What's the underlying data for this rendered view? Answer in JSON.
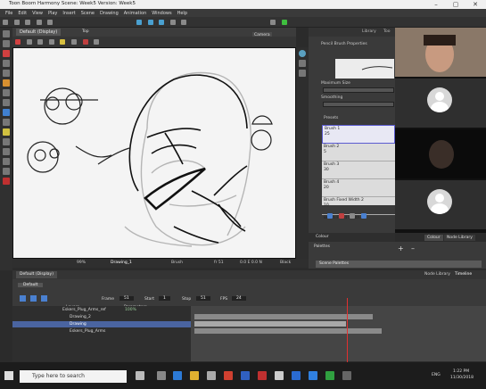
{
  "window": {
    "title": "Toon Boom Harmony Scene: Week5 Version: Week5",
    "controls": [
      "–",
      "▢",
      "✕"
    ]
  },
  "menu": [
    "File",
    "Edit",
    "View",
    "Play",
    "Insert",
    "Scene",
    "Drawing",
    "Animation",
    "Windows",
    "Help"
  ],
  "drawing_view": {
    "tab_label": "Default (Display)",
    "top_label": "Top",
    "camera_tab": "Camera",
    "drawing_tab": "Drawing"
  },
  "status": {
    "zoom": "99%",
    "drawing": "Drawing_1",
    "tool": "Brush",
    "frame": "fr 51",
    "coords": "0.0 E 0.0 N",
    "black": "Black"
  },
  "tool_properties": {
    "tabs": [
      "Library",
      "Too"
    ],
    "header": "Pencil Brush Properties",
    "max_size_label": "Maximum Size",
    "smoothing_label": "Smoothing",
    "presets_label": "Presets",
    "presets": [
      {
        "name": "Brush 1",
        "value": "25",
        "selected": true
      },
      {
        "name": "Brush 2",
        "value": "5"
      },
      {
        "name": "Brush 3",
        "value": "30"
      },
      {
        "name": "Brush 4",
        "value": "20"
      },
      {
        "name": "Brush Fixed Width 2",
        "value": "10"
      },
      {
        "name": "Brush Fixed Width 1",
        "value": ""
      }
    ]
  },
  "colour": {
    "tabs": [
      "Colour",
      "Node Library"
    ]
  },
  "palettes": {
    "label": "Palettes",
    "item": "Scene Palettes"
  },
  "timeline": {
    "tab_label": "Default (Display)",
    "tabs": [
      "Node Library",
      "Timeline"
    ],
    "default_view": "Default",
    "frame_label": "Frame",
    "frame_value": "51",
    "start_label": "Start",
    "start_value": "1",
    "stop_label": "Stop",
    "stop_value": "51",
    "fps_label": "FPS",
    "fps_value": "24",
    "layers_header": "Layers",
    "parameters_header": "Parameters",
    "layers": [
      {
        "name": "Eskers_Plug_Arms_ref",
        "value": "100%"
      },
      {
        "name": "Drawing_2",
        "value": ""
      },
      {
        "name": "Drawing",
        "value": ""
      },
      {
        "name": "Eskers_Plug_Arms",
        "value": ""
      }
    ]
  },
  "taskbar": {
    "search_placeholder": "Type here to search",
    "time": "1:22 PM",
    "date": "11/30/2018",
    "lang": "ENG"
  },
  "colors": {
    "accent": "#5b5bd0",
    "playhead": "#e03030",
    "sketch_gray": "#b5b5b5",
    "ink": "#111111"
  }
}
